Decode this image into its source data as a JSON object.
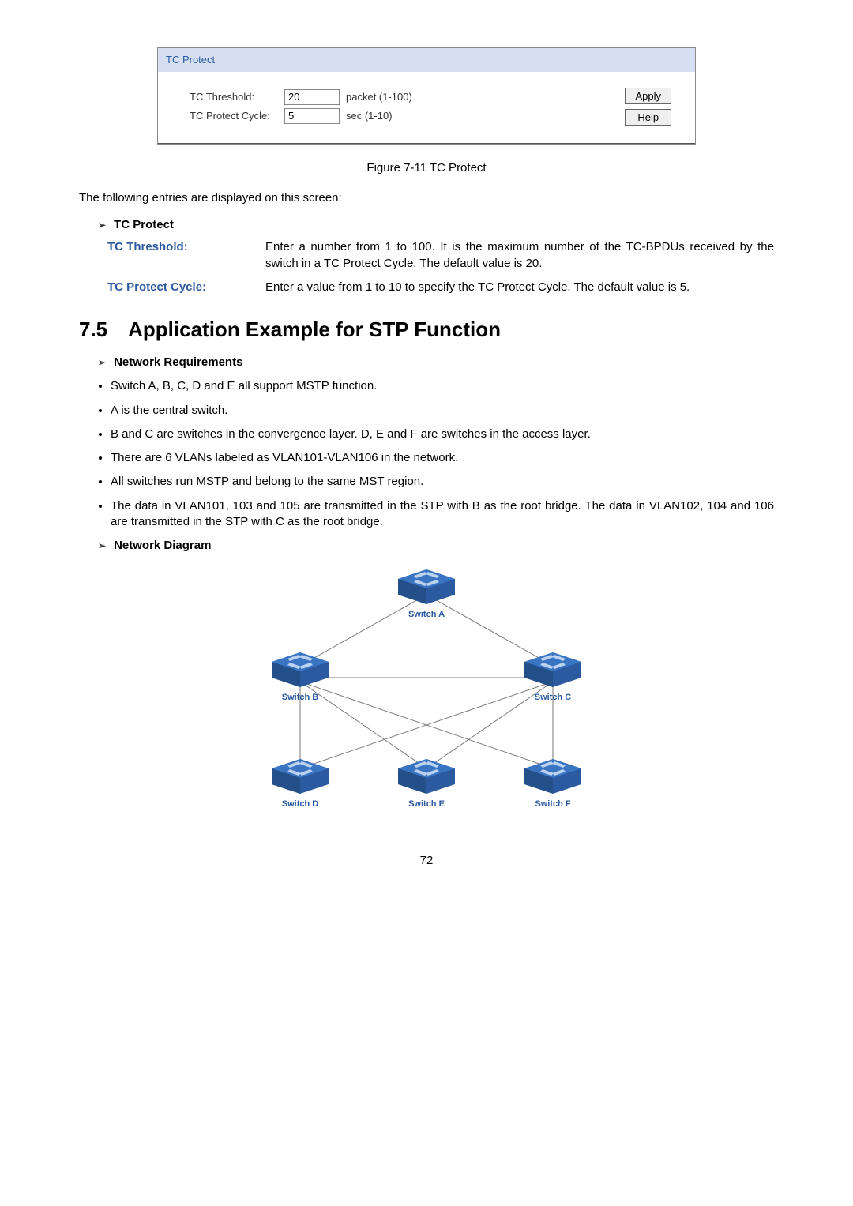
{
  "figure": {
    "header": "TC Protect",
    "row1_label": "TC Threshold:",
    "row1_value": "20",
    "row1_hint": "packet (1-100)",
    "row2_label": "TC Protect Cycle:",
    "row2_value": "5",
    "row2_hint": "sec (1-10)",
    "apply": "Apply",
    "help": "Help",
    "caption": "Figure 7-11 TC Protect"
  },
  "intro": "The following entries are displayed on this screen:",
  "tc_heading": "TC Protect",
  "def1_term": "TC Threshold:",
  "def1_text": "Enter a number from 1 to 100. It is the maximum number of the TC-BPDUs received by the switch in a TC Protect Cycle. The default value is 20.",
  "def2_term": "TC Protect Cycle:",
  "def2_text": "Enter a value from 1 to 10 to specify the TC Protect Cycle. The default value is 5.",
  "section_title": "7.5 Application Example for STP Function",
  "req_heading": "Network Requirements",
  "bullets": [
    "Switch A, B, C, D and E all support MSTP function.",
    "A is the central switch.",
    "B and C are switches in the convergence layer. D, E and F are switches in the access layer.",
    "There are 6 VLANs labeled as VLAN101-VLAN106 in the network.",
    "All switches run MSTP and belong to the same MST region.",
    "The data in VLAN101, 103 and 105 are transmitted in the STP with B as the root bridge. The data in VLAN102, 104 and 106 are transmitted in the STP with C as the root bridge."
  ],
  "diagram_heading": "Network Diagram",
  "switches": {
    "A": "Switch A",
    "B": "Switch B",
    "C": "Switch C",
    "D": "Switch D",
    "E": "Switch E",
    "F": "Switch F"
  },
  "page_number": "72"
}
